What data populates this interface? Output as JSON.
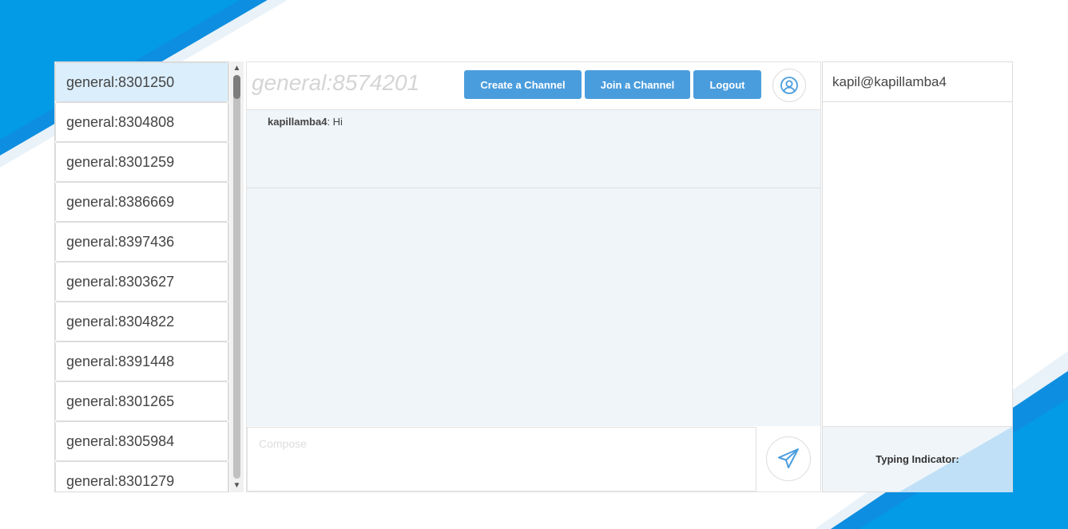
{
  "channels": [
    {
      "name": "general:8301250",
      "active": true
    },
    {
      "name": "general:8304808"
    },
    {
      "name": "general:8301259"
    },
    {
      "name": "general:8386669"
    },
    {
      "name": "general:8397436"
    },
    {
      "name": "general:8303627"
    },
    {
      "name": "general:8304822"
    },
    {
      "name": "general:8391448"
    },
    {
      "name": "general:8301265"
    },
    {
      "name": "general:8305984"
    },
    {
      "name": "general:8301279"
    }
  ],
  "header": {
    "channel_title": "general:8574201",
    "create_label": "Create a Channel",
    "join_label": "Join a Channel",
    "logout_label": "Logout",
    "profile_icon": "user-circle-icon"
  },
  "messages": [
    {
      "author": "kapillamba4",
      "separator": ": ",
      "text": "Hi"
    }
  ],
  "compose": {
    "placeholder": "Compose",
    "send_icon": "paper-plane-icon"
  },
  "users": [
    {
      "handle": "kapil@kapillamba4"
    }
  ],
  "typing": {
    "label": "Typing Indicator:"
  },
  "colors": {
    "accent": "#4a9ddd",
    "background_stripe": "#0095e6",
    "active_channel": "#dbeefc",
    "panel_bg": "#f0f5f9"
  }
}
